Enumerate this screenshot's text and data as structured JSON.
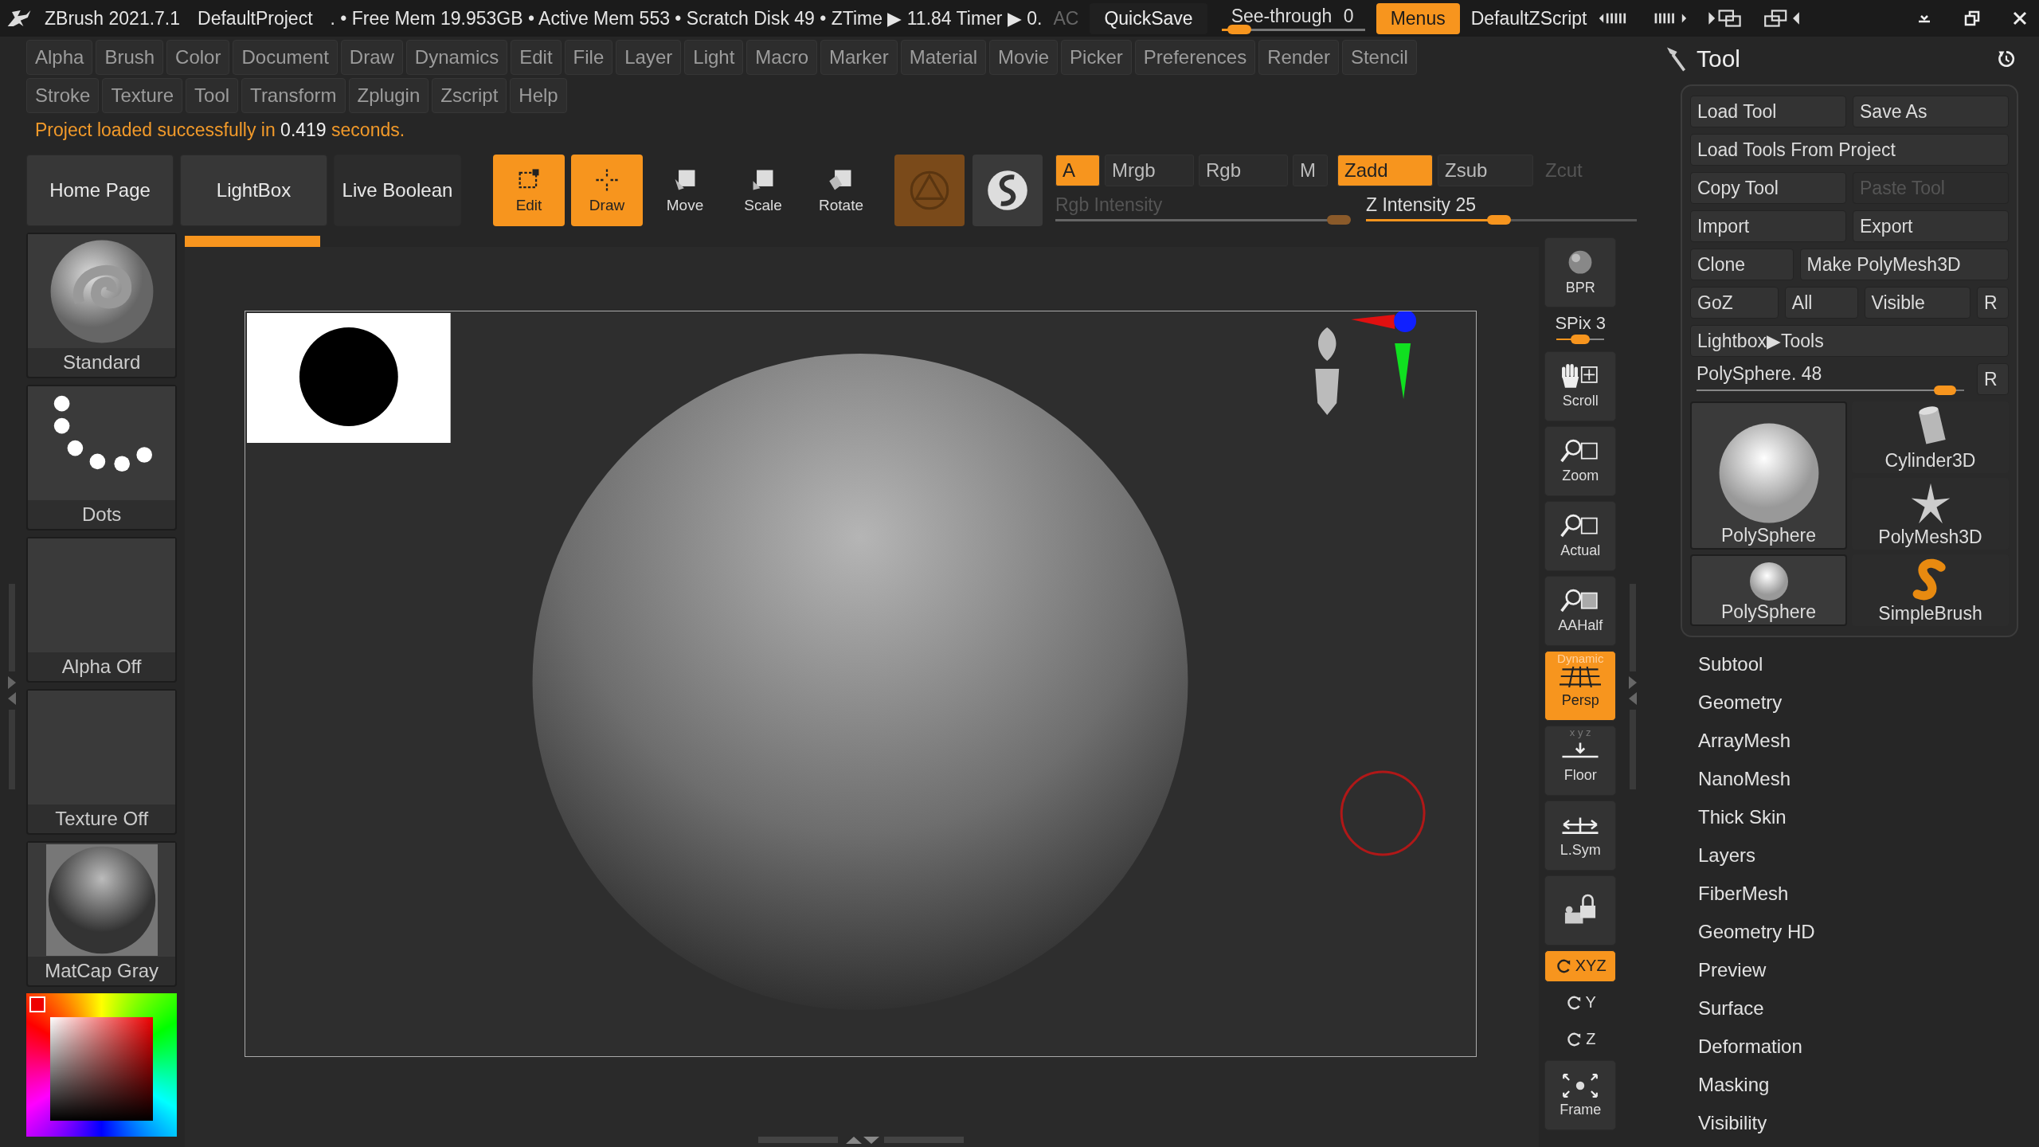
{
  "title_bar": {
    "app": "ZBrush 2021.7.1",
    "project": "DefaultProject",
    "stats": ". • Free Mem 19.953GB • Active Mem 553 • Scratch Disk 49 • ZTime ▶ 11.84 Timer ▶ 0.",
    "ac": "AC",
    "quicksave": "QuickSave",
    "see_through": {
      "label": "See-through",
      "value": "0",
      "level": 0.05
    },
    "menus": {
      "label": "Menus",
      "on": true
    },
    "script": "DefaultZScript"
  },
  "menu_rows": [
    [
      "Alpha",
      "Brush",
      "Color",
      "Document",
      "Draw",
      "Dynamics",
      "Edit",
      "File",
      "Layer",
      "Light",
      "Macro",
      "Marker",
      "Material",
      "Movie",
      "Picker",
      "Preferences",
      "Render",
      "Stencil"
    ],
    [
      "Stroke",
      "Texture",
      "Tool",
      "Transform",
      "Zplugin",
      "Zscript",
      "Help"
    ]
  ],
  "message": "Project loaded successfully in **0.419** seconds.",
  "toolbar": {
    "buttons": [
      "Home Page",
      "LightBox",
      "Live Boolean"
    ],
    "modes": [
      {
        "label": "Edit",
        "kind": "edit",
        "selected": true
      },
      {
        "label": "Draw",
        "kind": "draw",
        "selected": true
      },
      {
        "label": "Move",
        "kind": "move",
        "selected": false
      },
      {
        "label": "Scale",
        "kind": "scale",
        "selected": false
      },
      {
        "label": "Rotate",
        "kind": "rotate",
        "selected": false
      }
    ],
    "rgb_group": [
      {
        "label": "A",
        "on": true,
        "disabled": false
      },
      {
        "label": "Mrgb",
        "on": false,
        "disabled": false
      },
      {
        "label": "Rgb",
        "on": false,
        "disabled": false
      },
      {
        "label": "M",
        "on": false,
        "disabled": false
      }
    ],
    "z_group": [
      {
        "label": "Zadd",
        "on": true,
        "disabled": false
      },
      {
        "label": "Zsub",
        "on": false,
        "disabled": false
      },
      {
        "label": "Zcut",
        "on": false,
        "disabled": true
      }
    ],
    "rgb_intensity": {
      "label": "Rgb Intensity",
      "disabled": true,
      "level": 0.97
    },
    "z_intensity": {
      "label": "Z Intensity",
      "value": "25",
      "level": 0.5
    }
  },
  "shelf": [
    {
      "label": "Standard",
      "kind": "brush"
    },
    {
      "label": "Dots",
      "kind": "stroke"
    },
    {
      "label": "Alpha Off",
      "kind": "empty"
    },
    {
      "label": "Texture Off",
      "kind": "empty"
    },
    {
      "label": "MatCap Gray",
      "kind": "material"
    }
  ],
  "right_tools": [
    {
      "label": "BPR",
      "kind": "bpr",
      "on": false
    },
    {
      "label": "SPix 3",
      "kind": "slider",
      "level": 0.5
    },
    {
      "label": "Scroll",
      "kind": "scroll",
      "on": false
    },
    {
      "label": "Zoom",
      "kind": "zoom",
      "on": false
    },
    {
      "label": "Actual",
      "kind": "actual",
      "on": false
    },
    {
      "label": "AAHalf",
      "kind": "aahalf",
      "on": false
    },
    {
      "label": "Persp",
      "kind": "persp",
      "on": true,
      "badge": "Dynamic"
    },
    {
      "label": "Floor",
      "kind": "floor",
      "on": false,
      "badge": "x y z"
    },
    {
      "label": "L.Sym",
      "kind": "lsym",
      "on": false
    },
    {
      "kind": "lock",
      "on": false
    },
    {
      "label": "XYZ",
      "kind": "xyz",
      "on": true
    },
    {
      "label": "Y",
      "kind": "rot",
      "on": false
    },
    {
      "label": "Z",
      "kind": "rot",
      "on": false
    },
    {
      "label": "Frame",
      "kind": "frame",
      "on": false
    }
  ],
  "tool_panel": {
    "title": "Tool",
    "button_rows": [
      [
        {
          "label": "Load Tool",
          "disabled": false
        },
        {
          "label": "Save As",
          "disabled": false
        }
      ],
      [
        {
          "label": "Load Tools From Project",
          "disabled": false
        }
      ],
      [
        {
          "label": "Copy Tool",
          "disabled": false
        },
        {
          "label": "Paste Tool",
          "disabled": true
        }
      ],
      [
        {
          "label": "Import",
          "disabled": false
        },
        {
          "label": "Export",
          "disabled": false
        }
      ],
      [
        {
          "label": "Clone",
          "disabled": false
        },
        {
          "label": "Make PolyMesh3D",
          "disabled": false
        }
      ],
      [
        {
          "label": "GoZ",
          "disabled": false
        },
        {
          "label": "All",
          "disabled": false
        },
        {
          "label": "Visible",
          "disabled": false
        },
        {
          "label": "R",
          "disabled": false
        }
      ],
      [
        {
          "label": "Lightbox▶Tools",
          "disabled": false
        }
      ]
    ],
    "slider": {
      "label": "PolySphere. 48",
      "level": 0.93,
      "reset": "R"
    },
    "thumbnails": [
      {
        "label": "PolySphere",
        "kind": "sphere",
        "selected": true
      },
      {
        "label": "PolySphere",
        "kind": "sphere_small",
        "selected": true
      },
      {
        "label": "Cylinder3D",
        "kind": "cylinder",
        "selected": false
      },
      {
        "label": "PolyMesh3D",
        "kind": "star",
        "selected": false
      },
      {
        "label": "SimpleBrush",
        "kind": "brush",
        "selected": false
      }
    ],
    "subpalettes": [
      "Subtool",
      "Geometry",
      "ArrayMesh",
      "NanoMesh",
      "Thick Skin",
      "Layers",
      "FiberMesh",
      "Geometry HD",
      "Preview",
      "Surface",
      "Deformation",
      "Masking",
      "Visibility"
    ]
  }
}
